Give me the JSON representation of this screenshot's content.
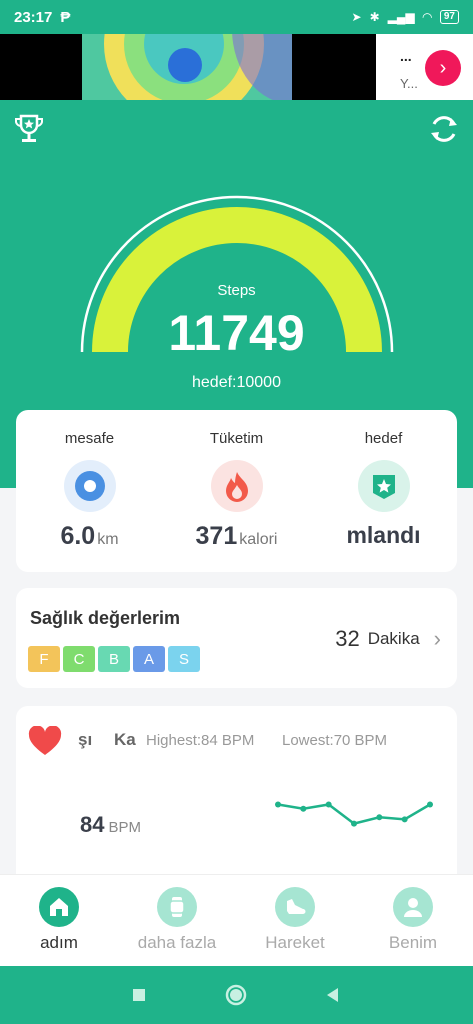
{
  "status": {
    "time": "23:17",
    "battery": "97"
  },
  "ad": {
    "dots": "...",
    "text": "Y...",
    "go": "›"
  },
  "hero": {
    "steps_label": "Steps",
    "steps_value": "11749",
    "goal": "hedef:10000",
    "progress": 1.0
  },
  "stats": [
    {
      "label": "mesafe",
      "value": "6.0",
      "unit": "km",
      "icon": "location-icon",
      "color": "#4a90e2"
    },
    {
      "label": "Tüketim",
      "value": "371",
      "unit": "kalori",
      "icon": "flame-icon",
      "color": "#f25a4a"
    },
    {
      "label": "hedef",
      "value": "mlandı",
      "unit": "",
      "icon": "star-badge-icon",
      "color": "#1fb38a"
    }
  ],
  "health": {
    "title": "Sağlık değerlerim",
    "grades": [
      {
        "letter": "F",
        "color": "#f3c45a"
      },
      {
        "letter": "C",
        "color": "#7fdc6e"
      },
      {
        "letter": "B",
        "color": "#68d9b2"
      },
      {
        "letter": "A",
        "color": "#6a9ae8"
      },
      {
        "letter": "S",
        "color": "#7bd3ee"
      }
    ],
    "minutes_value": "32",
    "minutes_label": "Dakika"
  },
  "heart": {
    "title_part1": "şı",
    "title_part2": "Ka",
    "highest": "Highest:84  BPM",
    "lowest": "Lowest:70  BPM",
    "bpm_value": "84",
    "bpm_unit": "BPM",
    "chart_values": [
      82,
      80,
      82,
      73,
      76,
      75,
      82
    ]
  },
  "tabs": [
    {
      "label": "adım",
      "icon": "home-icon",
      "active": true
    },
    {
      "label": "daha fazla",
      "icon": "watch-icon",
      "active": false
    },
    {
      "label": "Hareket",
      "icon": "shoe-icon",
      "active": false
    },
    {
      "label": "Benim",
      "icon": "profile-icon",
      "active": false
    }
  ],
  "colors": {
    "primary": "#1fb38a",
    "gauge": "#d9f23a"
  }
}
